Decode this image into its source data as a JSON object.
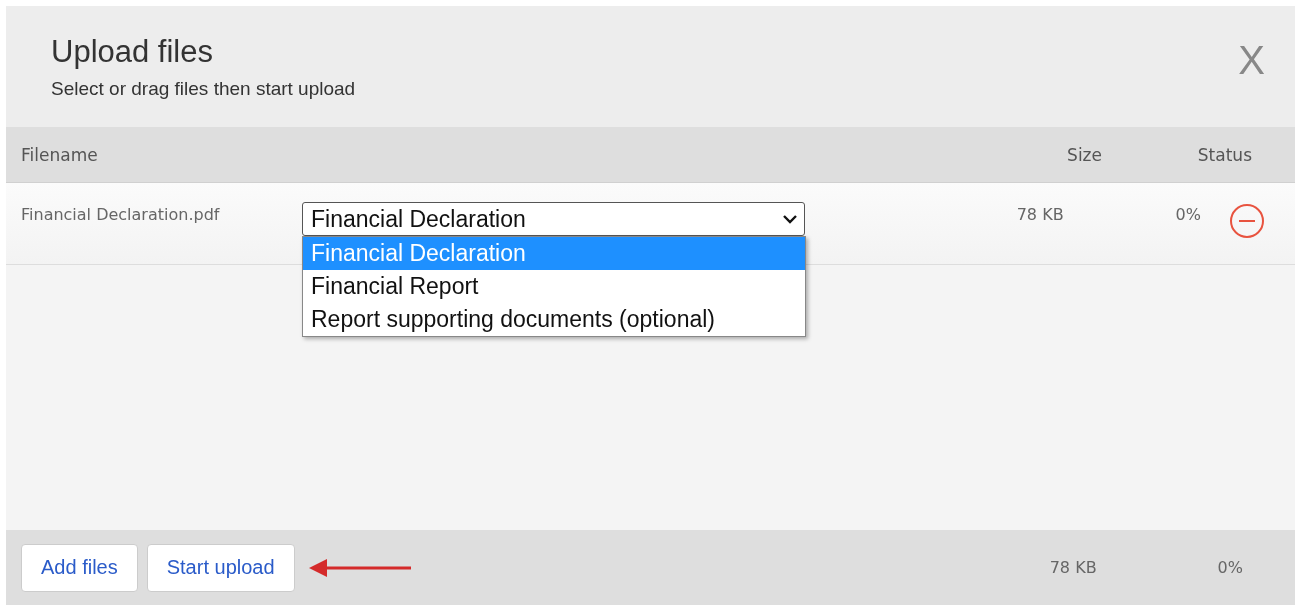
{
  "dialog": {
    "title": "Upload files",
    "subtitle": "Select or drag files then start upload",
    "close": "X"
  },
  "table": {
    "columns": [
      "Filename",
      "Size",
      "Status"
    ],
    "rows": [
      {
        "filename": "Financial Declaration.pdf",
        "type": {
          "value": "Financial Declaration",
          "expanded": true,
          "options": [
            {
              "label": "Financial Declaration",
              "selected": true
            },
            {
              "label": "Financial Report",
              "selected": false
            },
            {
              "label": "Report supporting documents (optional)",
              "selected": false
            }
          ]
        },
        "size": "78 KB",
        "status": "0%"
      }
    ]
  },
  "footer": {
    "buttons": [
      {
        "label": "Add files"
      },
      {
        "label": "Start upload",
        "pointed": true
      }
    ],
    "total_size": "78 KB",
    "total_status": "0%"
  }
}
